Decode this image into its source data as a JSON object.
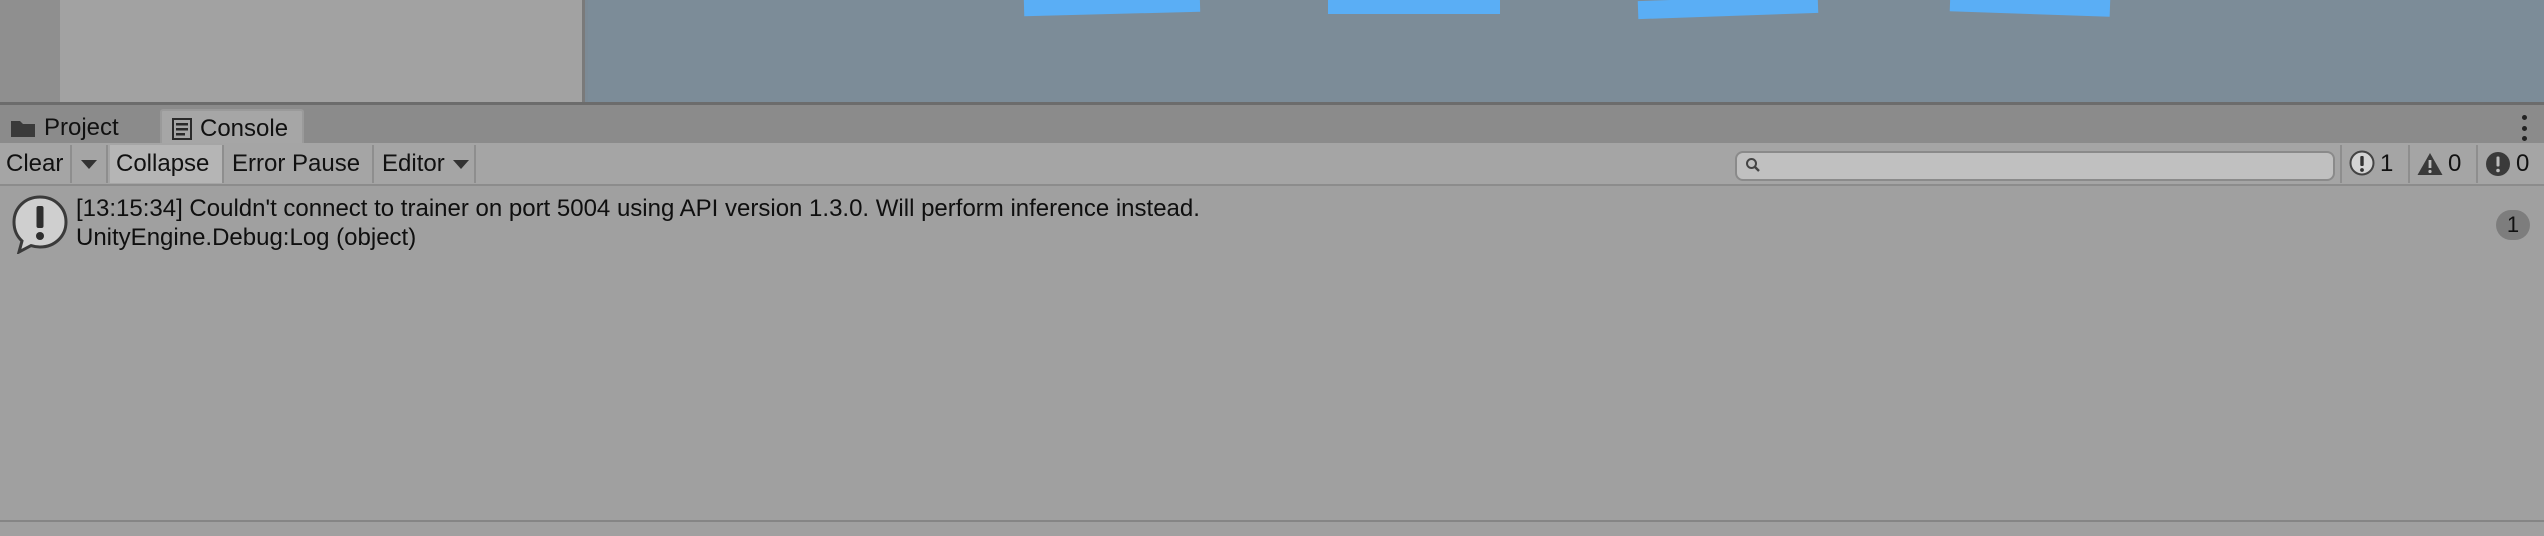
{
  "tabs": [
    {
      "label": "Project",
      "icon": "folder-icon"
    },
    {
      "label": "Console",
      "icon": "console-icon"
    }
  ],
  "toolbar": {
    "clear_label": "Clear",
    "collapse_label": "Collapse",
    "error_pause_label": "Error Pause",
    "editor_label": "Editor",
    "search_placeholder": "",
    "search_value": ""
  },
  "counters": {
    "info": "1",
    "warnings": "0",
    "errors": "0"
  },
  "log": {
    "entries": [
      {
        "message": "[13:15:34] Couldn't connect to trainer on port 5004 using API version 1.3.0. Will perform inference instead.",
        "trace": "UnityEngine.Debug:Log (object)",
        "count": "1",
        "icon": "info-icon"
      }
    ]
  },
  "colors": {
    "scene_background": "#7c8c98",
    "scene_card": "#5aaef5",
    "panel_background": "#a0a0a0"
  }
}
